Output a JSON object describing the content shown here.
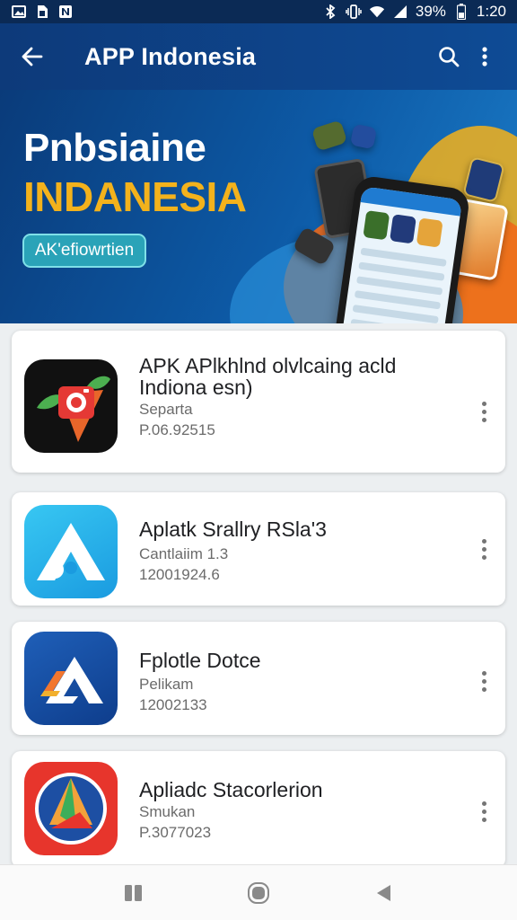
{
  "status_bar": {
    "left_icons": [
      "image-icon",
      "sim-icon",
      "notification-n-icon"
    ],
    "right_icons": [
      "bluetooth-icon",
      "vibrate-icon",
      "wifi-icon",
      "signal-icon",
      "battery-icon"
    ],
    "battery": "39%",
    "time": "1:20"
  },
  "app_bar": {
    "title": "APP Indonesia",
    "back_icon": "arrow-left-icon",
    "search_icon": "search-icon",
    "more_icon": "more-vertical-icon"
  },
  "banner": {
    "title": "Pnbsiaine",
    "subtitle": "INDANESIA",
    "cta_label": "AK'efiowrtien",
    "page_count": 3,
    "active_page": 2,
    "colors": {
      "title": "#ffffff",
      "subtitle": "#f3b21c",
      "cta_bg": "#2aa3b8"
    }
  },
  "apps": [
    {
      "name_line1": "APK APlkhlnd olvlcaing acld",
      "name_line2": "Indiona esn)",
      "category": "Separta",
      "meta": "P.06.92515",
      "icon": "camera-leaf-app-icon"
    },
    {
      "name_line1": "Aplatk Srallry RSla'3",
      "category": "Cantlaiim 1.3",
      "meta": "12001924.6",
      "icon": "triangle-a-app-icon"
    },
    {
      "name_line1": "Fplotle Dotce",
      "category": "Pelikam",
      "meta": "12002133",
      "icon": "stylized-a-app-icon"
    },
    {
      "name_line1": "Apliadc Stacorlerion",
      "category": "Smukan",
      "meta": "P.3077023",
      "icon": "compass-circle-app-icon"
    }
  ],
  "nav_bar": {
    "recents_icon": "recents-icon",
    "home_icon": "home-icon",
    "back_icon": "back-triangle-icon"
  }
}
